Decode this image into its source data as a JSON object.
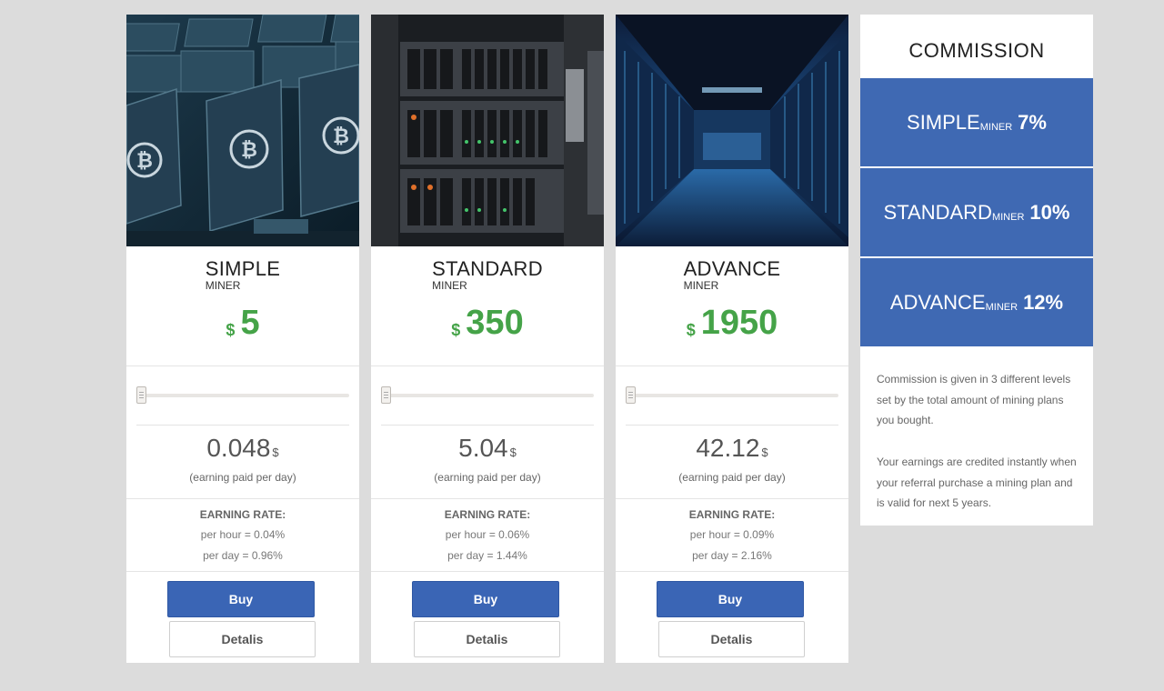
{
  "plans": [
    {
      "name": "SIMPLE",
      "sub": "MINER",
      "currency": "$",
      "price": "5",
      "slider_fraction": 0,
      "earning": "0.048",
      "earning_unit": "$",
      "earning_note": "(earning paid per day)",
      "rate_title": "EARNING RATE:",
      "per_hour": "per hour = 0.04%",
      "per_day": "per day = 0.96%",
      "buy_label": "Buy",
      "details_label": "Detalis",
      "photo": "gpu-mining-rig"
    },
    {
      "name": "STANDARD",
      "sub": "MINER",
      "currency": "$",
      "price": "350",
      "slider_fraction": 0,
      "earning": "5.04",
      "earning_unit": "$",
      "earning_note": "(earning paid per day)",
      "rate_title": "EARNING RATE:",
      "per_hour": "per hour = 0.06%",
      "per_day": "per day = 1.44%",
      "buy_label": "Buy",
      "details_label": "Detalis",
      "photo": "server-rack"
    },
    {
      "name": "ADVANCE",
      "sub": "MINER",
      "currency": "$",
      "price": "1950",
      "slider_fraction": 0,
      "earning": "42.12",
      "earning_unit": "$",
      "earning_note": "(earning paid per day)",
      "rate_title": "EARNING RATE:",
      "per_hour": "per hour = 0.09%",
      "per_day": "per day = 2.16%",
      "buy_label": "Buy",
      "details_label": "Detalis",
      "photo": "data-center-aisle"
    }
  ],
  "commission": {
    "title": "COMMISSION",
    "levels": [
      {
        "name": "SIMPLE",
        "sub": "MINER",
        "percent": "7%"
      },
      {
        "name": "STANDARD",
        "sub": "MINER",
        "percent": "10%"
      },
      {
        "name": "ADVANCE",
        "sub": "MINER",
        "percent": "12%"
      }
    ],
    "text1": "Commission is given in 3 different levels set by the total amount of mining plans you bought.",
    "text2": "Your earnings are credited instantly when your referral purchase a mining plan and is valid for next 5 years."
  },
  "colors": {
    "price_green": "#45a348",
    "button_blue": "#3a65b5",
    "commission_blue": "#3f69b3",
    "background": "#dcdcdc"
  }
}
